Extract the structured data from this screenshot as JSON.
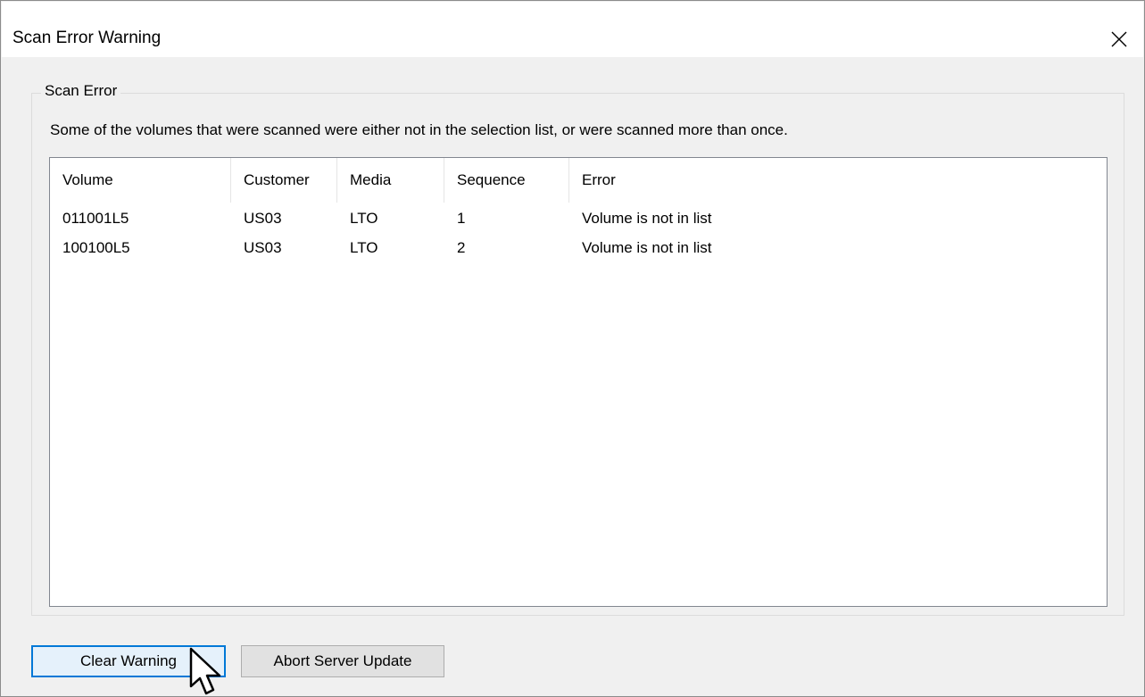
{
  "window": {
    "title": "Scan Error Warning"
  },
  "group": {
    "legend": "Scan Error",
    "message": "Some of the volumes that were scanned were either not in the selection list, or were scanned more than once."
  },
  "table": {
    "columns": [
      "Volume",
      "Customer",
      "Media",
      "Sequence",
      "Error"
    ],
    "rows": [
      [
        "011001L5",
        "US03",
        "LTO",
        "1",
        "Volume is not in list"
      ],
      [
        "100100L5",
        "US03",
        "LTO",
        "2",
        "Volume is not in list"
      ]
    ]
  },
  "buttons": {
    "clear_warning": "Clear Warning",
    "abort_server_update": "Abort Server Update"
  },
  "icons": {
    "close": "close-icon",
    "cursor": "mouse-pointer-icon"
  },
  "colors": {
    "default_button_border": "#0078d7",
    "default_button_fill": "#e5f1fb"
  }
}
